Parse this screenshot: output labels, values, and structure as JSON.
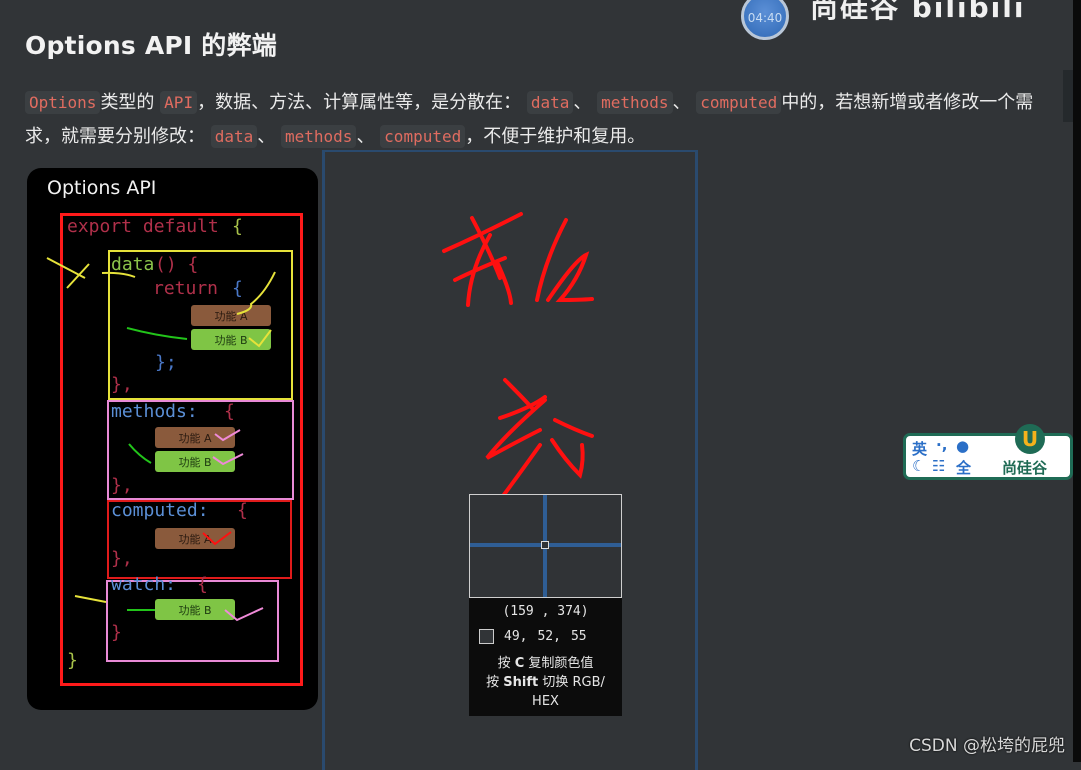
{
  "header": {
    "timer": "04:40",
    "brand_partial": "尚硅谷 bilibili"
  },
  "article": {
    "title": "Options API 的弊端",
    "paragraph": {
      "code_options": "Options",
      "t1": "类型的",
      "code_api": "API",
      "t2": "，数据、方法、计算属性等，是分散在：",
      "code_data": "data",
      "sep": "、",
      "code_methods": "methods",
      "code_computed": "computed",
      "t3": "中的，若想新增或者修改一个需求，就需要分别修改：",
      "t4": "，不便于维护和复用。"
    },
    "next_heading_partial": "..."
  },
  "diagram": {
    "title": "Options API",
    "code": {
      "export_default": "export default",
      "open_brace": "{",
      "data_fn": "data",
      "data_parens": "() {",
      "return": "return",
      "return_brace": "{",
      "return_close": "};",
      "close_comma": "},",
      "methods": "methods:",
      "computed": "computed:",
      "watch": "watch:",
      "close_brace": "}",
      "final_brace": "}"
    },
    "features": {
      "a": "功能 A",
      "b": "功能 B"
    },
    "colors": {
      "outer_box": "#ff1a1a",
      "data_box": "#e6e23a",
      "methods_box": "#e88ad6",
      "computed_box": "#e01b1b",
      "watch_box": "#e88ad6",
      "feature_a": "#8a5a3c",
      "feature_b": "#7fc545"
    }
  },
  "annotation": {
    "handwritten_1": "数",
    "handwritten_2": "据",
    "ink_color": "#ff1010"
  },
  "color_picker": {
    "coords": "(159 , 374)",
    "rgb": [
      "49,",
      "52,",
      "55"
    ],
    "hint_line1_pre": "按",
    "hint_key1": "C",
    "hint_line1_post": "复制颜色值",
    "hint_line2_pre": "按",
    "hint_key2": "Shift",
    "hint_line2_post": "切换 RGB/",
    "hint_line3": "HEX"
  },
  "ime": {
    "lang": "英",
    "punct": "·,",
    "mode": "全",
    "brand": "尚硅谷",
    "logo": "U"
  },
  "watermark": "CSDN @松垮的屁兜"
}
